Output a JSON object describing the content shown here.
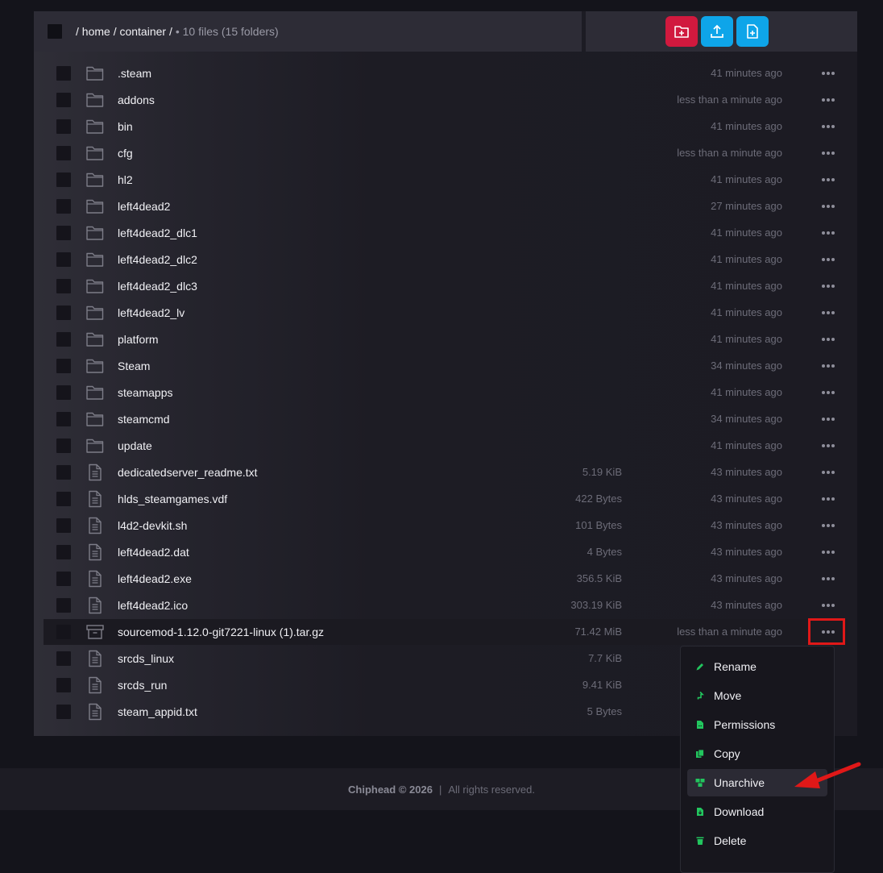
{
  "header": {
    "path": "/ home / container /",
    "meta": "• 10 files (15 folders)",
    "buttons": [
      {
        "name": "new-folder",
        "icon": "folder-plus-icon",
        "color": "#d1193e"
      },
      {
        "name": "upload",
        "icon": "upload-icon",
        "color": "#0ea5e9"
      },
      {
        "name": "new-file",
        "icon": "file-plus-icon",
        "color": "#0ea5e9"
      }
    ]
  },
  "files": [
    {
      "name": ".steam",
      "type": "folder",
      "size": "",
      "modified": "41 minutes ago"
    },
    {
      "name": "addons",
      "type": "folder",
      "size": "",
      "modified": "less than a minute ago"
    },
    {
      "name": "bin",
      "type": "folder",
      "size": "",
      "modified": "41 minutes ago"
    },
    {
      "name": "cfg",
      "type": "folder",
      "size": "",
      "modified": "less than a minute ago"
    },
    {
      "name": "hl2",
      "type": "folder",
      "size": "",
      "modified": "41 minutes ago"
    },
    {
      "name": "left4dead2",
      "type": "folder",
      "size": "",
      "modified": "27 minutes ago"
    },
    {
      "name": "left4dead2_dlc1",
      "type": "folder",
      "size": "",
      "modified": "41 minutes ago"
    },
    {
      "name": "left4dead2_dlc2",
      "type": "folder",
      "size": "",
      "modified": "41 minutes ago"
    },
    {
      "name": "left4dead2_dlc3",
      "type": "folder",
      "size": "",
      "modified": "41 minutes ago"
    },
    {
      "name": "left4dead2_lv",
      "type": "folder",
      "size": "",
      "modified": "41 minutes ago"
    },
    {
      "name": "platform",
      "type": "folder",
      "size": "",
      "modified": "41 minutes ago"
    },
    {
      "name": "Steam",
      "type": "folder",
      "size": "",
      "modified": "34 minutes ago"
    },
    {
      "name": "steamapps",
      "type": "folder",
      "size": "",
      "modified": "41 minutes ago"
    },
    {
      "name": "steamcmd",
      "type": "folder",
      "size": "",
      "modified": "34 minutes ago"
    },
    {
      "name": "update",
      "type": "folder",
      "size": "",
      "modified": "41 minutes ago"
    },
    {
      "name": "dedicatedserver_readme.txt",
      "type": "file",
      "size": "5.19 KiB",
      "modified": "43 minutes ago"
    },
    {
      "name": "hlds_steamgames.vdf",
      "type": "file",
      "size": "422 Bytes",
      "modified": "43 minutes ago"
    },
    {
      "name": "l4d2-devkit.sh",
      "type": "file",
      "size": "101 Bytes",
      "modified": "43 minutes ago"
    },
    {
      "name": "left4dead2.dat",
      "type": "file",
      "size": "4 Bytes",
      "modified": "43 minutes ago"
    },
    {
      "name": "left4dead2.exe",
      "type": "file",
      "size": "356.5 KiB",
      "modified": "43 minutes ago"
    },
    {
      "name": "left4dead2.ico",
      "type": "file",
      "size": "303.19 KiB",
      "modified": "43 minutes ago"
    },
    {
      "name": "sourcemod-1.12.0-git7221-linux (1).tar.gz",
      "type": "archive",
      "size": "71.42 MiB",
      "modified": "less than a minute ago",
      "highlighted": true
    },
    {
      "name": "srcds_linux",
      "type": "file",
      "size": "7.7 KiB",
      "modified": ""
    },
    {
      "name": "srcds_run",
      "type": "file",
      "size": "9.41 KiB",
      "modified": ""
    },
    {
      "name": "steam_appid.txt",
      "type": "file",
      "size": "5 Bytes",
      "modified": ""
    }
  ],
  "context_menu": {
    "items": [
      {
        "label": "Rename",
        "icon": "pencil-icon"
      },
      {
        "label": "Move",
        "icon": "arrow-up-icon"
      },
      {
        "label": "Permissions",
        "icon": "file-code-icon"
      },
      {
        "label": "Copy",
        "icon": "copy-icon"
      },
      {
        "label": "Unarchive",
        "icon": "boxes-icon",
        "active": true
      },
      {
        "label": "Download",
        "icon": "file-download-icon"
      },
      {
        "label": "Delete",
        "icon": "trash-icon"
      }
    ],
    "icon_color": "#22c55e"
  },
  "footer": {
    "brand": "Chiphead © 2026",
    "separator": "|",
    "rights": "All rights reserved."
  },
  "annotation_color": "#e01818"
}
